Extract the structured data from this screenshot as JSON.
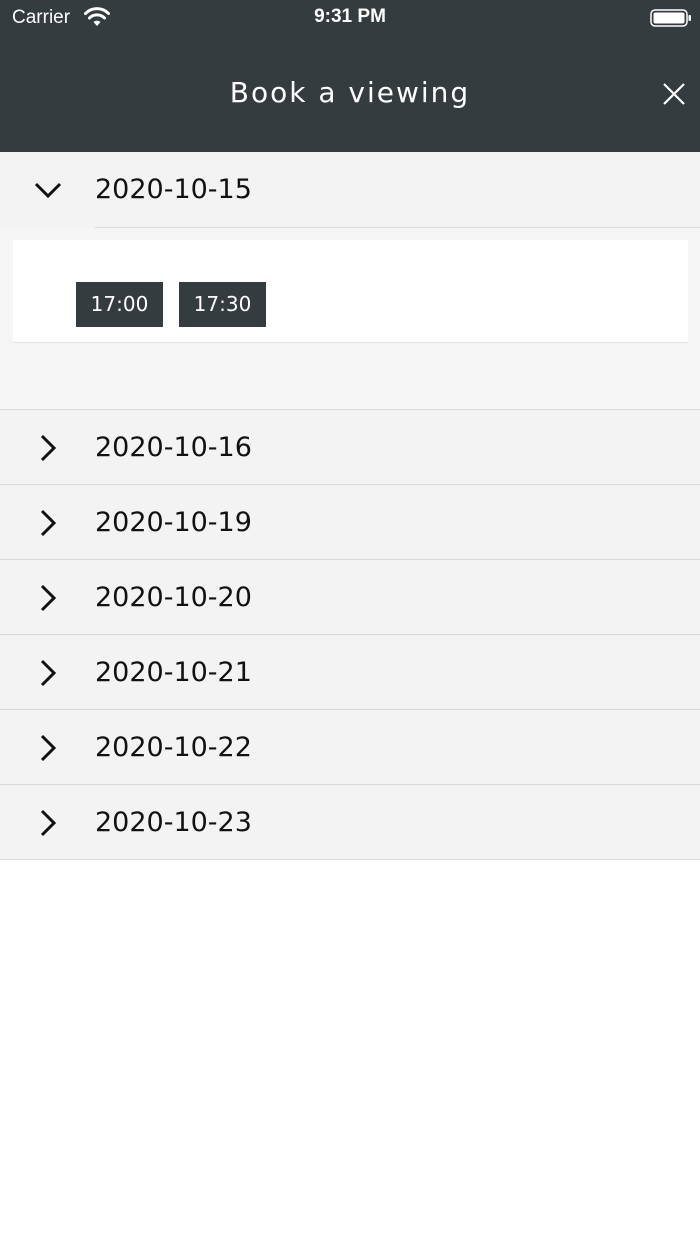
{
  "status_bar": {
    "carrier": "Carrier",
    "time": "9:31 PM"
  },
  "header": {
    "title": "Book a viewing",
    "close_icon": "close-icon"
  },
  "dates": [
    {
      "label": "2020-10-15",
      "expanded": true,
      "slots": [
        "17:00",
        "17:30"
      ]
    },
    {
      "label": "2020-10-16",
      "expanded": false
    },
    {
      "label": "2020-10-19",
      "expanded": false
    },
    {
      "label": "2020-10-20",
      "expanded": false
    },
    {
      "label": "2020-10-21",
      "expanded": false
    },
    {
      "label": "2020-10-22",
      "expanded": false
    },
    {
      "label": "2020-10-23",
      "expanded": false
    }
  ],
  "colors": {
    "header_bg": "#353c3f",
    "row_bg": "#f3f3f3",
    "slot_bg": "#353c3f"
  }
}
